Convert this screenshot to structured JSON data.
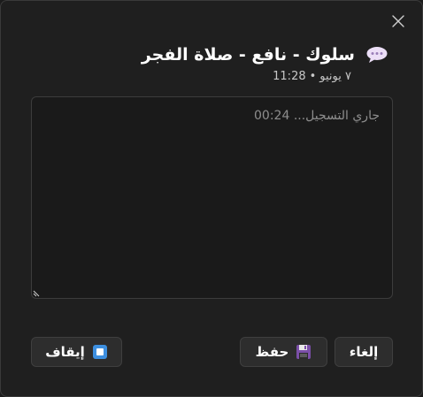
{
  "note": {
    "title": "سلوك - نافع - صلاة الفجر",
    "date": "٧ يونيو",
    "separator": "•",
    "time": "11:28"
  },
  "editor": {
    "status_label": "جاري التسجيل...",
    "elapsed": "00:24"
  },
  "buttons": {
    "cancel_label": "إلغاء",
    "save_label": "حفظ",
    "stop_label": "إيقاف"
  },
  "colors": {
    "background": "#1f1f1f",
    "button_bg": "#2d2d2d",
    "save_icon": "#7b4fa8",
    "stop_icon": "#3d8fe0"
  },
  "icons": {
    "close": "close-icon",
    "chat": "speech-bubble-icon",
    "save": "floppy-disk-icon",
    "stop": "stop-icon"
  }
}
